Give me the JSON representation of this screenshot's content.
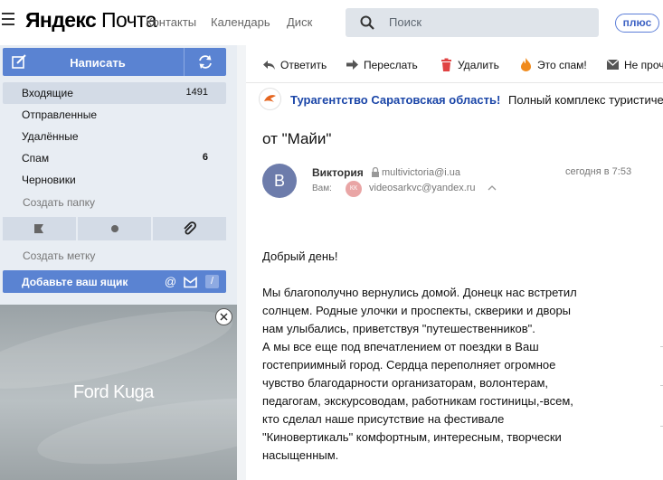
{
  "header": {
    "logo_brand": "Яндекс",
    "logo_product": "Почта",
    "nav": [
      "Контакты",
      "Календарь",
      "Диск"
    ],
    "search_placeholder": "Поиск",
    "plus_label": "плюс"
  },
  "sidebar": {
    "compose_label": "Написать",
    "folders": [
      {
        "name": "Входящие",
        "count": "1491"
      },
      {
        "name": "Отправленные",
        "count": ""
      },
      {
        "name": "Удалённые",
        "count": ""
      },
      {
        "name": "Спам",
        "count": "6"
      },
      {
        "name": "Черновики",
        "count": ""
      }
    ],
    "create_folder": "Создать папку",
    "create_label": "Создать метку",
    "add_mailbox": "Добавьте ваш ящик",
    "ad_title": "Ford Kuga"
  },
  "toolbar": {
    "reply": "Ответить",
    "forward": "Переслать",
    "delete": "Удалить",
    "spam": "Это спам!",
    "unread": "Не проч"
  },
  "message": {
    "sender_org": "Турагентство Саратовская область!",
    "snippet": "Полный комплекс туристиче...",
    "title": "от \"Майи\"",
    "from_initial": "В",
    "from_name": "Виктория",
    "from_email": "multivictoria@i.ua",
    "date": "сегодня в 7:53",
    "to_label": "Вам:",
    "to_badge": "КК",
    "to_email": "videosarkvc@yandex.ru",
    "greeting": "Добрый день!",
    "lines": [
      "Мы благополучно вернулись домой. Донецк нас встретил",
      "солнцем. Родные улочки и проспекты, скверики и дворы",
      "нам улыбались, приветствуя \"путешественников\".",
      "А мы все еще под впечатлением от поездки в Ваш",
      "гостеприимный город. Сердца переполняет огромное",
      "чувство благодарности организаторам, волонтерам,",
      "педагогам, экскурсоводам, работникам гостиницы,-всем,",
      "кто сделал наше присутствие на фестивале",
      "\"Киновертикаль\" комфортным, интересным, творчески",
      "насыщенным."
    ]
  },
  "colors": {
    "accent": "#5a83d2",
    "sidebar_bg": "#e8edf3",
    "link": "#1b46a8"
  }
}
